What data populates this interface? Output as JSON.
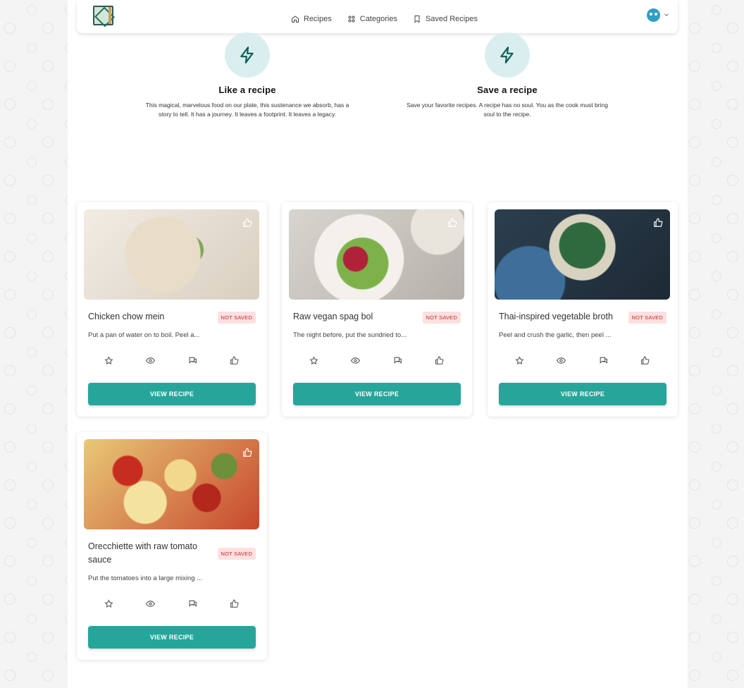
{
  "nav": {
    "links": [
      {
        "label": "Recipes",
        "icon": "home-icon"
      },
      {
        "label": "Categories",
        "icon": "grid-icon"
      },
      {
        "label": "Saved Recipes",
        "icon": "bookmark-icon"
      }
    ]
  },
  "features": [
    {
      "title": "Like a recipe",
      "text": "This magical, marvelous food on our plate, this sustenance we absorb, has a story to tell. It has a journey. It leaves a footprint. It leaves a legacy.",
      "icon": "lightning-icon"
    },
    {
      "title": "Save a recipe",
      "text": "Save your favorite recipes. A recipe has no soul. You as the cook must bring soul to the recipe.",
      "icon": "lightning-icon"
    }
  ],
  "recipes": [
    {
      "title": "Chicken chow mein",
      "badge": "NOT SAVED",
      "desc": "Put a pan of water on to boil. Peel a...",
      "button": "VIEW RECIPE"
    },
    {
      "title": "Raw vegan spag bol",
      "badge": "NOT SAVED",
      "desc": "The night before, put the sundried to...",
      "button": "VIEW RECIPE"
    },
    {
      "title": "Thai-inspired vegetable broth",
      "badge": "NOT SAVED",
      "desc": "Peel and crush the garlic, then peel ...",
      "button": "VIEW RECIPE"
    },
    {
      "title": "Orecchiette with raw tomato sauce",
      "badge": "NOT SAVED",
      "desc": "Put the tomatoes into a large mixing ...",
      "button": "VIEW RECIPE"
    }
  ],
  "colors": {
    "accent": "#26a69a",
    "badge_text": "#c62828",
    "badge_bg": "#fde0e0",
    "feature_icon_bg": "#daeef0"
  }
}
